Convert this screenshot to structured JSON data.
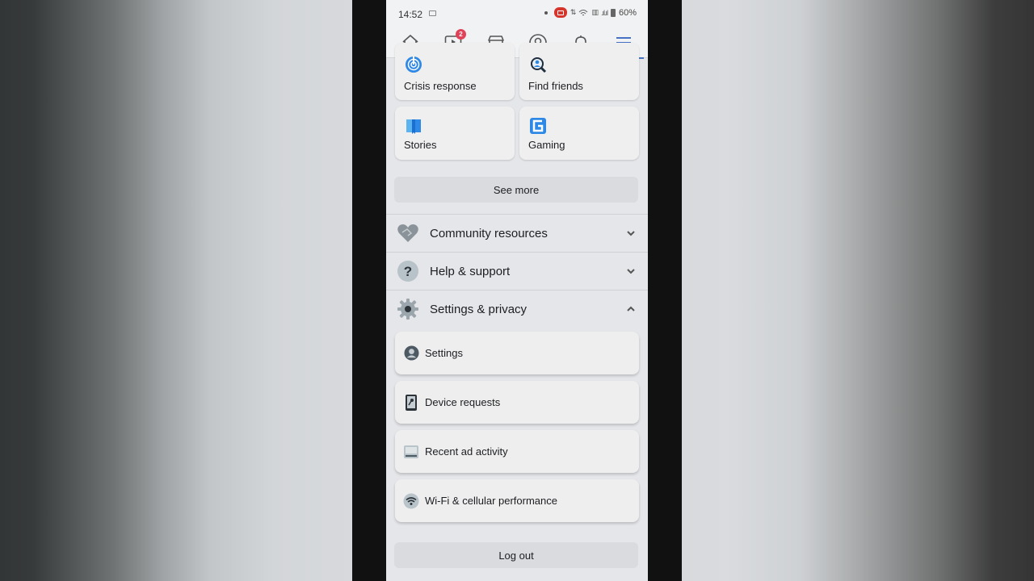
{
  "status_bar": {
    "time": "14:52",
    "battery": "60%"
  },
  "nav": {
    "items": [
      {
        "name": "home",
        "active": false
      },
      {
        "name": "watch",
        "badge": "2",
        "active": false
      },
      {
        "name": "marketplace",
        "active": false
      },
      {
        "name": "profile",
        "active": false
      },
      {
        "name": "notifications",
        "active": false
      },
      {
        "name": "menu",
        "active": true
      }
    ],
    "accent": "#4671c4"
  },
  "shortcuts": [
    {
      "label": "Crisis response",
      "icon": "crisis-response-icon"
    },
    {
      "label": "Find friends",
      "icon": "find-friends-icon"
    },
    {
      "label": "Stories",
      "icon": "stories-icon"
    },
    {
      "label": "Gaming",
      "icon": "gaming-icon"
    }
  ],
  "see_more_label": "See more",
  "sections": [
    {
      "label": "Community resources",
      "icon": "handshake-heart-icon",
      "expanded": false
    },
    {
      "label": "Help & support",
      "icon": "question-icon",
      "expanded": false
    },
    {
      "label": "Settings & privacy",
      "icon": "gear-icon",
      "expanded": true
    }
  ],
  "settings_items": [
    {
      "label": "Settings",
      "icon": "user-circle-icon"
    },
    {
      "label": "Device requests",
      "icon": "phone-key-icon"
    },
    {
      "label": "Recent ad activity",
      "icon": "ad-activity-icon"
    },
    {
      "label": "Wi-Fi & cellular performance",
      "icon": "wifi-icon"
    }
  ],
  "logout_label": "Log out"
}
